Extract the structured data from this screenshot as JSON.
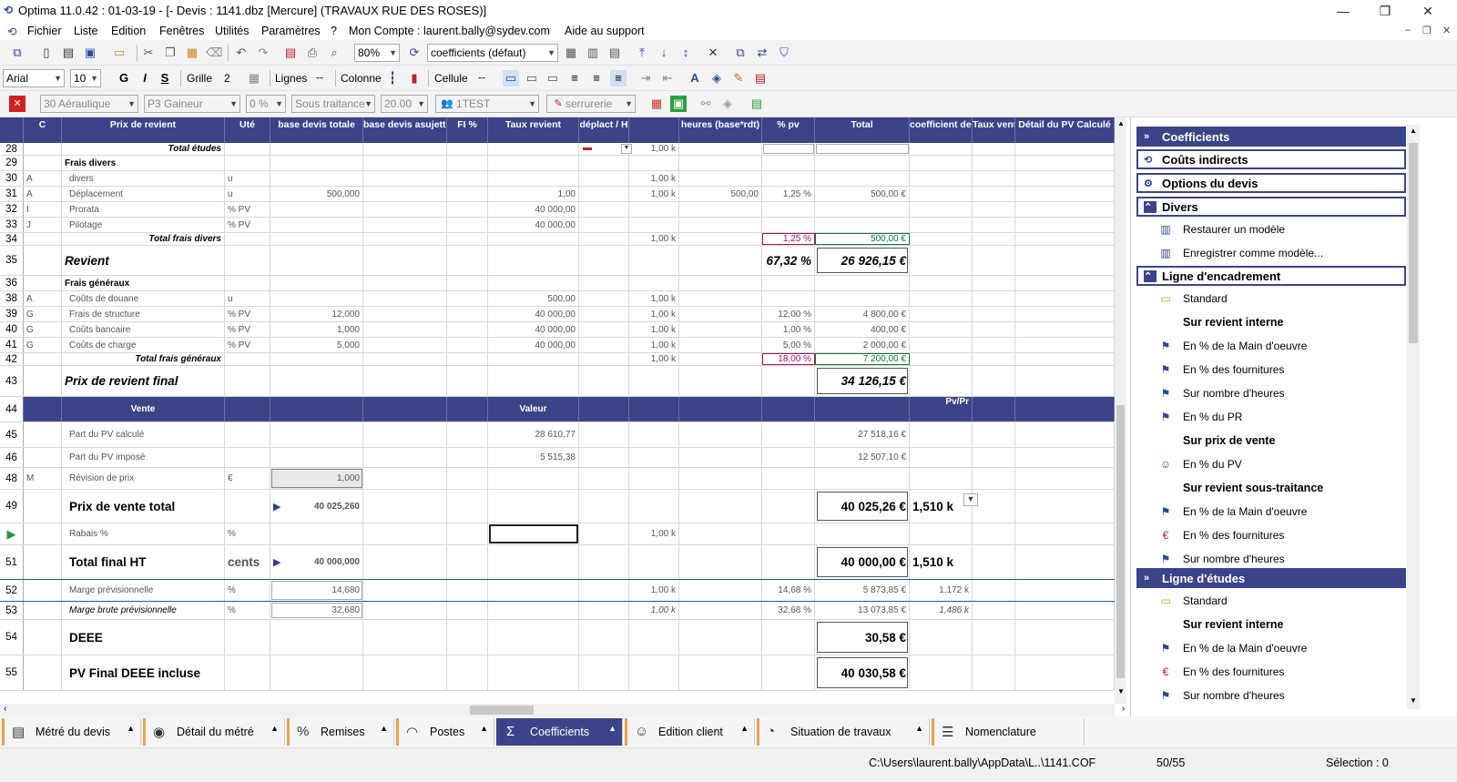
{
  "window": {
    "title": "Optima 11.0.42 : 01-03-19 - [- Devis : 1141.dbz [Mercure] (TRAVAUX RUE DES ROSES)]"
  },
  "menu": [
    "Fichier",
    "Liste",
    "Edition",
    "Fenêtres",
    "Utilités",
    "Paramètres",
    "?",
    "Mon Compte : laurent.bally@sydev.com",
    "Aide au support"
  ],
  "toolbar": {
    "zoom": "80%",
    "coef_select": "coefficients (défaut)"
  },
  "format": {
    "font": "Arial",
    "size": "10",
    "bold": "G",
    "italic": "I",
    "underline": "S",
    "grille_label": "Grille",
    "grille_value": "2",
    "lignes_label": "Lignes",
    "colonne_label": "Colonne",
    "cellule_label": "Cellule"
  },
  "filters": {
    "f1": "30 Aéraulique",
    "f2": "P3 Gaineur",
    "f3": "0 %",
    "f4": "Sous traitance",
    "f5": "20.00",
    "user": "1TEST",
    "trade": "serrurerie"
  },
  "headers": {
    "c": "C",
    "prix": "Prix de revient",
    "ute": "Uté",
    "base_totale": "base devis totale",
    "base_assujettie": "base devis asujettie",
    "fi": "FI %",
    "taux_revient": "Taux revient",
    "deplact": "déplact / H",
    "blank": "",
    "heures": "heures (base*rdt)",
    "pct_pv": "% pv",
    "total": "Total",
    "coef_vente": "coefficient de vente",
    "taux_vente": "Taux vente",
    "detail_pv": "Détail du PV Calculé"
  },
  "rows": [
    {
      "n": "28",
      "label": "Total études",
      "k": "1,00 k"
    },
    {
      "n": "29",
      "label": "Frais divers"
    },
    {
      "n": "30",
      "c": "A",
      "label": "divers",
      "ute": "u",
      "k": "1,00 k"
    },
    {
      "n": "31",
      "c": "A",
      "label": "Déplacement",
      "ute": "u",
      "base": "500,000",
      "taux": "1,00",
      "k": "1,00 k",
      "heures": "500,00",
      "pct": "1,25 %",
      "total": "500,00 €"
    },
    {
      "n": "32",
      "c": "I",
      "label": "Prorata",
      "ute": "% PV",
      "taux": "40 000,00"
    },
    {
      "n": "33",
      "c": "J",
      "label": "Pilotage",
      "ute": "% PV",
      "taux": "40 000,00"
    },
    {
      "n": "34",
      "label": "Total frais divers",
      "k": "1,00 k",
      "pct": "1,25 %",
      "total": "500,00 €"
    },
    {
      "n": "35",
      "label": "Revient",
      "pct": "67,32 %",
      "total": "26 926,15 €"
    },
    {
      "n": "36",
      "label": "Frais généraux"
    },
    {
      "n": "38",
      "c": "A",
      "label": "Coûts de douane",
      "ute": "u",
      "taux": "500,00",
      "k": "1,00 k"
    },
    {
      "n": "39",
      "c": "G",
      "label": "Frais de structure",
      "ute": "% PV",
      "base": "12,000",
      "taux": "40 000,00",
      "k": "1,00 k",
      "pct": "12,00 %",
      "total": "4 800,00 €"
    },
    {
      "n": "40",
      "c": "G",
      "label": "Coûts bancaire",
      "ute": "% PV",
      "base": "1,000",
      "taux": "40 000,00",
      "k": "1,00 k",
      "pct": "1,00 %",
      "total": "400,00 €"
    },
    {
      "n": "41",
      "c": "G",
      "label": "Coûts de charge",
      "ute": "% PV",
      "base": "5,000",
      "taux": "40 000,00",
      "k": "1,00 k",
      "pct": "5,00 %",
      "total": "2 000,00 €"
    },
    {
      "n": "42",
      "label": "Total frais généraux",
      "k": "1,00 k",
      "pct": "18,00 %",
      "total": "7 200,00 €"
    },
    {
      "n": "43",
      "label": "Prix de revient final",
      "total": "34 126,15 €"
    },
    {
      "n": "44",
      "label": "Vente",
      "valeur": "Valeur",
      "pvpr": "Pv/Pr"
    },
    {
      "n": "45",
      "label": "Part du PV calculé",
      "taux": "28 610,77",
      "total": "27 518,16 €"
    },
    {
      "n": "46",
      "label": "Part du PV imposé",
      "taux": "5 515,38",
      "total": "12 507,10 €"
    },
    {
      "n": "48",
      "c": "M",
      "label": "Révision de prix",
      "ute": "€",
      "base": "1,000"
    },
    {
      "n": "49",
      "label": "Prix de vente total",
      "base": "40 025,260",
      "total": "40 025,26 €",
      "coef": "1,510 k"
    },
    {
      "n": "",
      "label": "Rabais %",
      "ute": "%",
      "k": "1,00 k"
    },
    {
      "n": "51",
      "label": "Total final HT",
      "ute": "cents",
      "base": "40 000,000",
      "total": "40 000,00 €",
      "coef": "1,510 k"
    },
    {
      "n": "52",
      "label": "Marge prévisionnelle",
      "ute": "%",
      "base": "14,680",
      "k": "1,00 k",
      "pct": "14,68 %",
      "total": "5 873,85 €",
      "coef": "1,172 k"
    },
    {
      "n": "53",
      "label": "Marge brute prévisionnelle",
      "ute": "%",
      "base": "32,680",
      "k": "1,00 k",
      "pct": "32,68 %",
      "total": "13 073,85 €",
      "coef": "1,486 k"
    },
    {
      "n": "54",
      "label": "DEEE",
      "total": "30,58 €"
    },
    {
      "n": "55",
      "label": "PV Final DEEE incluse",
      "total": "40 030,58 €"
    }
  ],
  "panel": {
    "coefficients": "Coefficients",
    "couts_indirects": "Coûts indirects",
    "options": "Options du devis",
    "divers": "Divers",
    "restaurer": "Restaurer un modèle",
    "enregistrer": "Enregistrer comme modèle...",
    "ligne_encadrement": "Ligne d'encadrement",
    "standard": "Standard",
    "sur_revient_interne": "Sur revient interne",
    "main_oeuvre": "En % de la Main d'oeuvre",
    "fournitures": "En % des fournitures",
    "nombre_heures": "Sur nombre d'heures",
    "pct_pr": "En % du PR",
    "sur_prix_vente": "Sur prix de vente",
    "pct_pv": "En % du PV",
    "sur_revient_st": "Sur revient sous-traitance",
    "ligne_etudes": "Ligne d'études"
  },
  "tabs": [
    "Métré du devis",
    "Détail du métré",
    "Remises",
    "Postes",
    "Coefficients",
    "Edition client",
    "Situation de travaux",
    "Nomenclature"
  ],
  "status": {
    "path": "C:\\Users\\laurent.bally\\AppData\\L..\\1141.COF",
    "count": "50/55",
    "selection": "Sélection : 0"
  }
}
